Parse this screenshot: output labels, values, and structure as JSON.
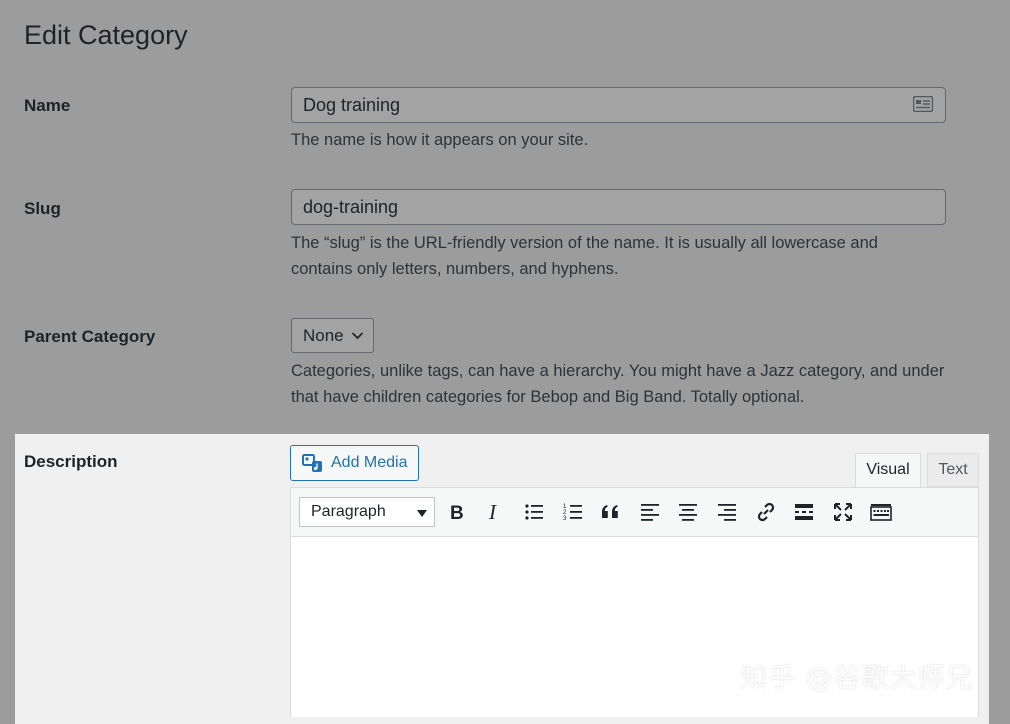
{
  "page": {
    "title": "Edit Category"
  },
  "name_field": {
    "label": "Name",
    "value": "Dog training",
    "help": "The name is how it appears on your site."
  },
  "slug_field": {
    "label": "Slug",
    "value": "dog-training",
    "help": "The “slug” is the URL-friendly version of the name. It is usually all lowercase and contains only letters, numbers, and hyphens."
  },
  "parent_field": {
    "label": "Parent Category",
    "selected": "None",
    "help": "Categories, unlike tags, can have a hierarchy. You might have a Jazz category, and under that have children categories for Bebop and Big Band. Totally optional."
  },
  "description_field": {
    "label": "Description",
    "add_media_label": "Add Media",
    "tabs": {
      "visual": "Visual",
      "text": "Text"
    },
    "toolbar": {
      "format_selected": "Paragraph",
      "buttons": [
        "bold-icon",
        "italic-icon",
        "bulleted-list-icon",
        "numbered-list-icon",
        "blockquote-icon",
        "align-left-icon",
        "align-center-icon",
        "align-right-icon",
        "link-icon",
        "read-more-icon",
        "fullscreen-icon",
        "toolbar-toggle-icon"
      ]
    }
  },
  "watermark": "知乎 @谷歌大师兄",
  "colors": {
    "accent": "#2271b1",
    "overlay": "#9c9c9c"
  }
}
